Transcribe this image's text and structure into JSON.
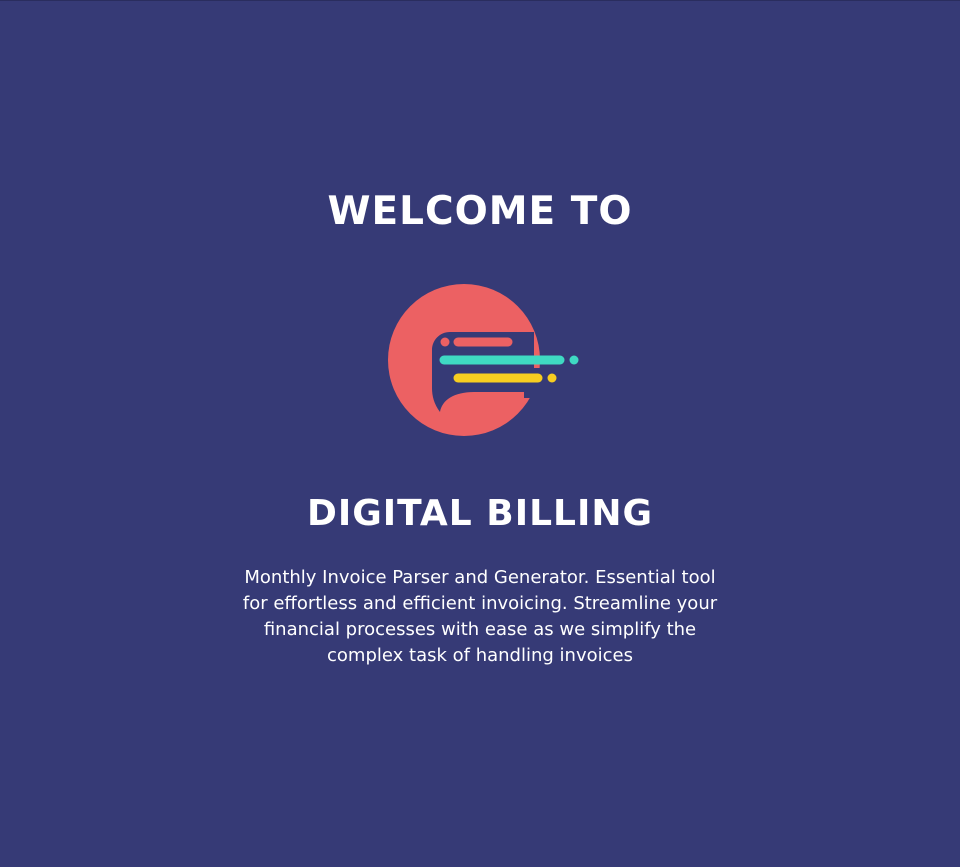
{
  "welcome": {
    "heading": "WELCOME TO",
    "app_name": "DIGITAL BILLING",
    "description": "Monthly Invoice Parser and Generator. Essential tool for effortless and efficient invoicing. Streamline your financial processes with ease as we simplify the complex task of handling invoices"
  },
  "logo": {
    "icon": "e-logo-icon",
    "colors": {
      "ring": "#ec6163",
      "teal": "#3fd9c3",
      "yellow": "#f7cd21"
    }
  },
  "colors": {
    "background": "#363a76",
    "text": "#ffffff"
  }
}
